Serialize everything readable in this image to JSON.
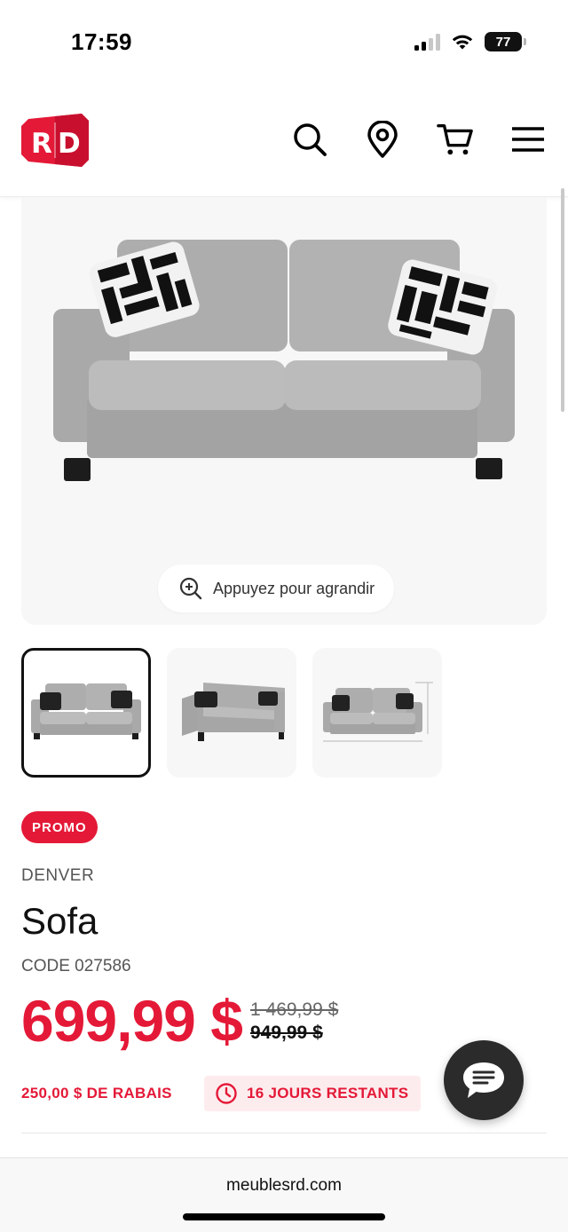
{
  "status_bar": {
    "time": "17:59",
    "battery": "77"
  },
  "header": {
    "logo_text": "RD",
    "brand_color": "#e41937",
    "icons": [
      "search-icon",
      "location-pin-icon",
      "cart-icon",
      "menu-icon"
    ]
  },
  "gallery": {
    "zoom_hint": "Appuyez pour agrandir",
    "thumbnails": [
      "front-view",
      "angled-view",
      "dimensions-view"
    ],
    "active_thumbnail": 0
  },
  "product": {
    "promo_badge": "PROMO",
    "brand": "DENVER",
    "name": "Sofa",
    "code": "CODE 027586",
    "price": "699,99 $",
    "old_price_1": "1 469,99 $",
    "old_price_2": "949,99 $",
    "discount": "250,00 $ DE RABAIS",
    "countdown": "16 JOURS RESTANTS"
  },
  "browser": {
    "url": "meublesrd.com"
  }
}
